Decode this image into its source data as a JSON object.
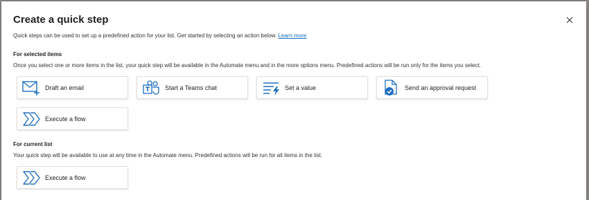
{
  "dialog": {
    "title": "Create a quick step",
    "intro_text": "Quick steps can be used to set up a predefined action for your list. Get started by selecting an action below.",
    "learn_more": "Learn more"
  },
  "selected_items": {
    "title": "For selected items",
    "description": "Once you select one or more items in the list, your quick step will be available in the Automate menu and in the more options menu. Predefined actions will be run only for the items you select.",
    "actions": [
      {
        "label": "Draft an email",
        "icon": "email-add-icon"
      },
      {
        "label": "Start a Teams chat",
        "icon": "teams-icon"
      },
      {
        "label": "Set a value",
        "icon": "set-value-icon"
      },
      {
        "label": "Send an approval request",
        "icon": "approval-icon"
      },
      {
        "label": "Execute a flow",
        "icon": "flow-icon"
      }
    ]
  },
  "current_list": {
    "title": "For current list",
    "description": "Your quick step will be available to use at any time in the Automate menu. Predefined actions will be run for all items in the list.",
    "actions": [
      {
        "label": "Execute a flow",
        "icon": "flow-icon"
      }
    ]
  },
  "colors": {
    "accent": "#0f6cbd",
    "teams_purple": "#5b5fc7",
    "icon_blue": "#1e6fc2"
  }
}
